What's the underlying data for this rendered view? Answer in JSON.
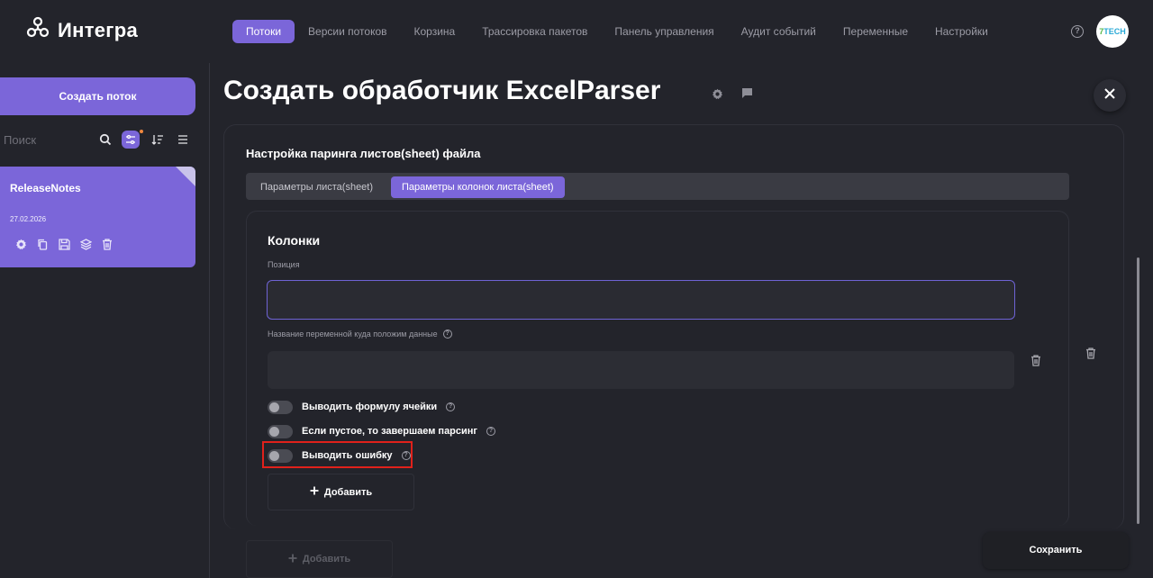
{
  "app": {
    "name": "Интегра"
  },
  "nav": {
    "items": [
      {
        "label": "Потоки",
        "active": true
      },
      {
        "label": "Версии потоков",
        "active": false
      },
      {
        "label": "Корзина",
        "active": false
      },
      {
        "label": "Трассировка пакетов",
        "active": false
      },
      {
        "label": "Панель управления",
        "active": false
      },
      {
        "label": "Аудит событий",
        "active": false
      },
      {
        "label": "Переменные",
        "active": false
      },
      {
        "label": "Настройки",
        "active": false
      }
    ],
    "help_icon": "?",
    "avatar_text_prefix": "7",
    "avatar_text": "TECH"
  },
  "sidebar": {
    "create_label": "Создать поток",
    "search_placeholder": "Поиск",
    "flows": [
      {
        "name": "ReleaseNotes",
        "date": "27.02.2026"
      }
    ]
  },
  "main": {
    "title": "Создать обработчик ExcelParser",
    "section_title": "Настройка паринга листов(sheet) файла",
    "tabs": [
      {
        "label": "Параметры листа(sheet)",
        "active": false
      },
      {
        "label": "Параметры колонок листа(sheet)",
        "active": true
      }
    ],
    "columns_title": "Колонки",
    "position_label": "Позиция",
    "position_value": "",
    "variable_label": "Название переменной куда положим данные",
    "variable_value": "",
    "toggles": [
      {
        "label": "Выводить формулу ячейки",
        "on": false
      },
      {
        "label": "Если пустое, то завершаем парсинг",
        "on": false
      },
      {
        "label": "Выводить ошибку",
        "on": false
      }
    ],
    "add_label": "Добавить",
    "add_label_outer": "Добавить",
    "save_label": "Сохранить",
    "help_glyph": "?"
  },
  "colors": {
    "accent": "#7b66d9",
    "background": "#23242b",
    "highlight": "#e0211b"
  },
  "icons": [
    "logo-icon",
    "help-icon",
    "search-icon",
    "filter-icon",
    "sort-icon",
    "list-icon",
    "gear-icon",
    "copy-icon",
    "save-icon",
    "layers-icon",
    "trash-icon",
    "comment-icon",
    "close-icon",
    "plus-icon"
  ]
}
